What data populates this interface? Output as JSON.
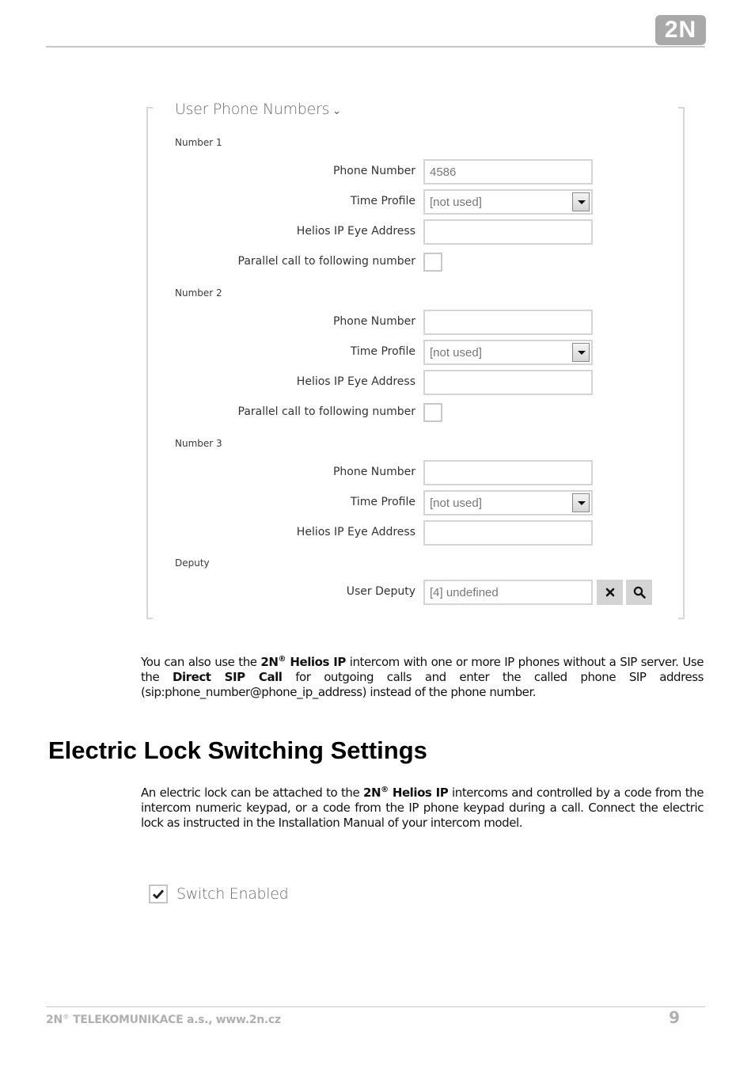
{
  "header": {
    "logo_text": "2N"
  },
  "panel": {
    "title": "User Phone Numbers",
    "title_chevron": "⌄",
    "groups": [
      {
        "label": "Number 1",
        "phone_number_label": "Phone Number",
        "phone_number_value": "4586",
        "time_profile_label": "Time Profile",
        "time_profile_value": "[not used]",
        "eye_address_label": "Helios IP Eye Address",
        "eye_address_value": "",
        "parallel_label": "Parallel call to following number",
        "parallel_checked": false
      },
      {
        "label": "Number 2",
        "phone_number_label": "Phone Number",
        "phone_number_value": "",
        "time_profile_label": "Time Profile",
        "time_profile_value": "[not used]",
        "eye_address_label": "Helios IP Eye Address",
        "eye_address_value": "",
        "parallel_label": "Parallel call to following number",
        "parallel_checked": false
      },
      {
        "label": "Number 3",
        "phone_number_label": "Phone Number",
        "phone_number_value": "",
        "time_profile_label": "Time Profile",
        "time_profile_value": "[not used]",
        "eye_address_label": "Helios IP Eye Address",
        "eye_address_value": ""
      }
    ],
    "deputy": {
      "label": "Deputy",
      "user_deputy_label": "User Deputy",
      "user_deputy_value": "[4] undefined",
      "clear_icon": "close-icon",
      "search_icon": "search-icon"
    }
  },
  "paragraph1": {
    "t1": "You can also use the ",
    "brand": "2N",
    "reg": "®",
    "product": " Helios IP",
    "t2": " intercom with one or more IP phones without a SIP server. Use the ",
    "bold2": "Direct SIP Call",
    "t3": " for outgoing calls and enter the called phone SIP address (sip:phone_number@phone_ip_address) instead of the phone number."
  },
  "heading": "Electric Lock Switching Settings",
  "paragraph2": {
    "t1": "An electric lock can be attached to the ",
    "brand": "2N",
    "reg": "®",
    "product": " Helios IP",
    "t2": " intercoms and controlled by a code from the intercom numeric keypad, or a code from the IP phone keypad during a call. Connect the electric lock as instructed in the Installation Manual of your intercom model."
  },
  "switch": {
    "label": "Switch Enabled",
    "checked": true
  },
  "footer": {
    "company_brand": "2N",
    "reg": "®",
    "company_rest": " TELEKOMUNIKACE a.s., www.2n.cz",
    "page_number": "9"
  }
}
